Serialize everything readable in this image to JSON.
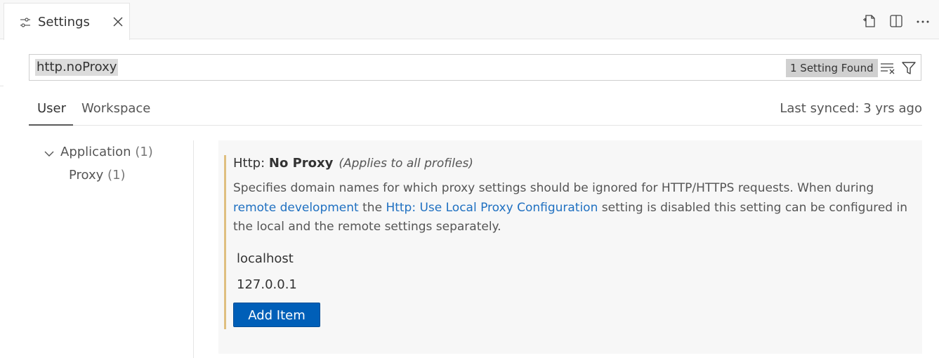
{
  "tab": {
    "label": "Settings",
    "icon": "settings-sliders-icon",
    "close_icon": "close-icon"
  },
  "editor_actions": [
    {
      "icon": "open-settings-json-icon"
    },
    {
      "icon": "split-editor-icon"
    },
    {
      "icon": "more-actions-icon"
    }
  ],
  "search": {
    "value": "http.noProxy",
    "result_count": "1 Setting Found",
    "clear_icon": "clear-filter-icon",
    "filter_icon": "filter-icon"
  },
  "scope_tabs": [
    {
      "label": "User",
      "active": true
    },
    {
      "label": "Workspace",
      "active": false
    }
  ],
  "sync": {
    "text": "Last synced: 3 yrs ago"
  },
  "toc": {
    "group": {
      "label": "Application",
      "count": "(1)",
      "expanded": true
    },
    "child": {
      "label": "Proxy",
      "count": "(1)"
    }
  },
  "setting": {
    "category": "Http: ",
    "name": "No Proxy",
    "scope_note": "(Applies to all profiles)",
    "desc_part1": "Specifies domain names for which proxy settings should be ignored for HTTP/HTTPS requests. When during ",
    "desc_link1": "remote development",
    "desc_part2": " the ",
    "desc_link2": "Http: Use Local Proxy Configuration",
    "desc_part3": " setting is disabled this setting can be configured in the local and the remote settings separately.",
    "items": [
      "localhost",
      "127.0.0.1"
    ],
    "add_button": "Add Item"
  },
  "colors": {
    "accent": "#005fb8",
    "link": "#1f70c1",
    "modified_indicator": "#dfbf80"
  }
}
